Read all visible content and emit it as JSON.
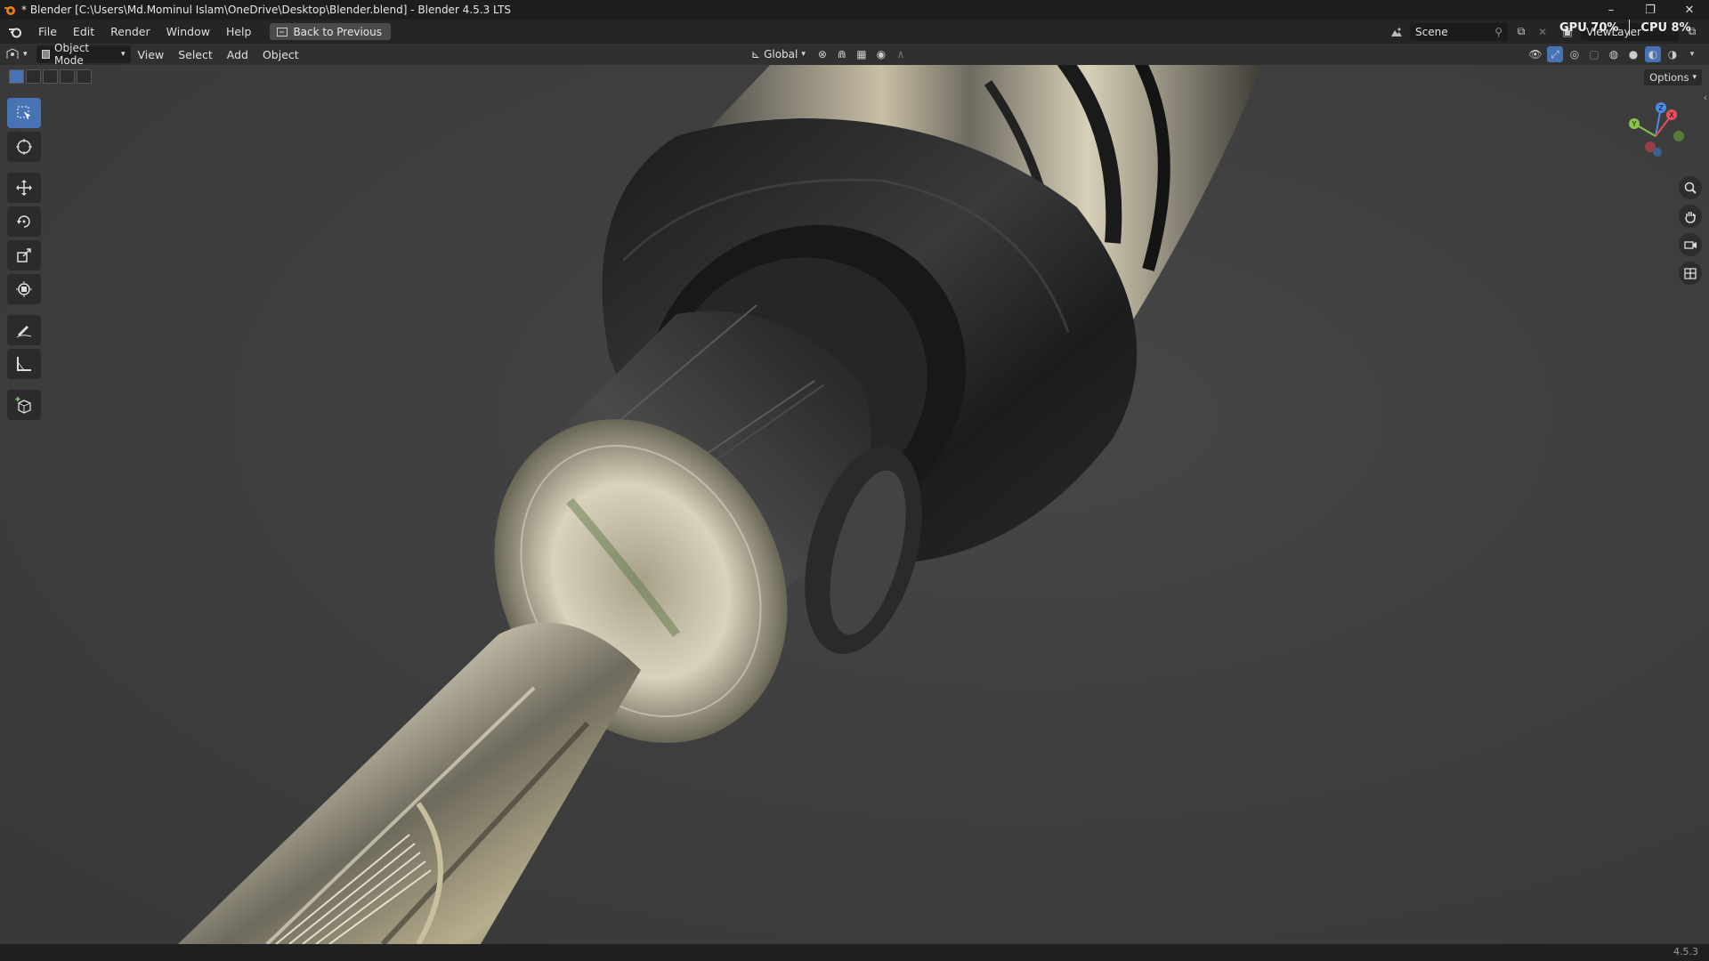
{
  "titlebar": {
    "title": "* Blender [C:\\Users\\Md.Mominul Islam\\OneDrive\\Desktop\\Blender.blend] - Blender 4.5.3 LTS",
    "minimize": "–",
    "restore": "❐",
    "close": "✕"
  },
  "menubar": {
    "items": [
      "File",
      "Edit",
      "Render",
      "Window",
      "Help"
    ],
    "back_button": "Back to Previous",
    "scene_label": "Scene",
    "viewlayer_label": "ViewLayer"
  },
  "stats": {
    "gpu": "GPU 70%",
    "cpu": "CPU 8%"
  },
  "header": {
    "mode": "Object Mode",
    "menus": [
      "View",
      "Select",
      "Add",
      "Object"
    ],
    "transform_orientation": "Global"
  },
  "viewport": {
    "options_label": "Options",
    "gizmo": {
      "x": "X",
      "y": "Y",
      "z": "Z"
    },
    "toolbar_tools": [
      "select-box",
      "cursor",
      "move",
      "rotate",
      "scale",
      "transform",
      "annotate",
      "measure",
      "add-cube"
    ],
    "nav_icons": [
      "zoom-icon",
      "hand-pan-icon",
      "camera-icon",
      "ortho-grid-icon"
    ]
  },
  "colors": {
    "accent": "#4772b3",
    "bg": "#3d3d3d",
    "titlebar": "#1d1d1d"
  },
  "statusbar": {
    "version": "4.5.3"
  }
}
